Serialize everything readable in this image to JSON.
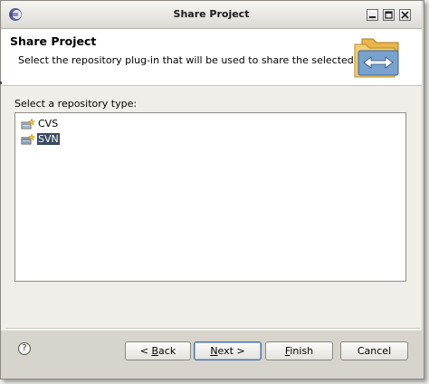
{
  "window": {
    "title": "Share Project",
    "controls": [
      "minimize",
      "maximize",
      "close"
    ]
  },
  "header": {
    "title": "Share Project",
    "description": "Select the repository plug-in that will be used to share the selected project."
  },
  "repository": {
    "label": "Select a repository type:",
    "items": [
      {
        "label": "CVS",
        "icon": "cvs-repository-icon",
        "selected": false
      },
      {
        "label": "SVN",
        "icon": "svn-repository-icon",
        "selected": true
      }
    ]
  },
  "buttons": {
    "back": {
      "mnemonic": "B",
      "rest": "ack",
      "prefix": "< "
    },
    "next": {
      "mnemonic": "N",
      "rest": "ext >"
    },
    "finish": {
      "mnemonic": "F",
      "rest": "inish"
    },
    "cancel": {
      "label": "Cancel"
    },
    "help": {
      "label": "?"
    }
  },
  "colors": {
    "selection": "#3a4a61",
    "window_bg": "#efeee9"
  }
}
